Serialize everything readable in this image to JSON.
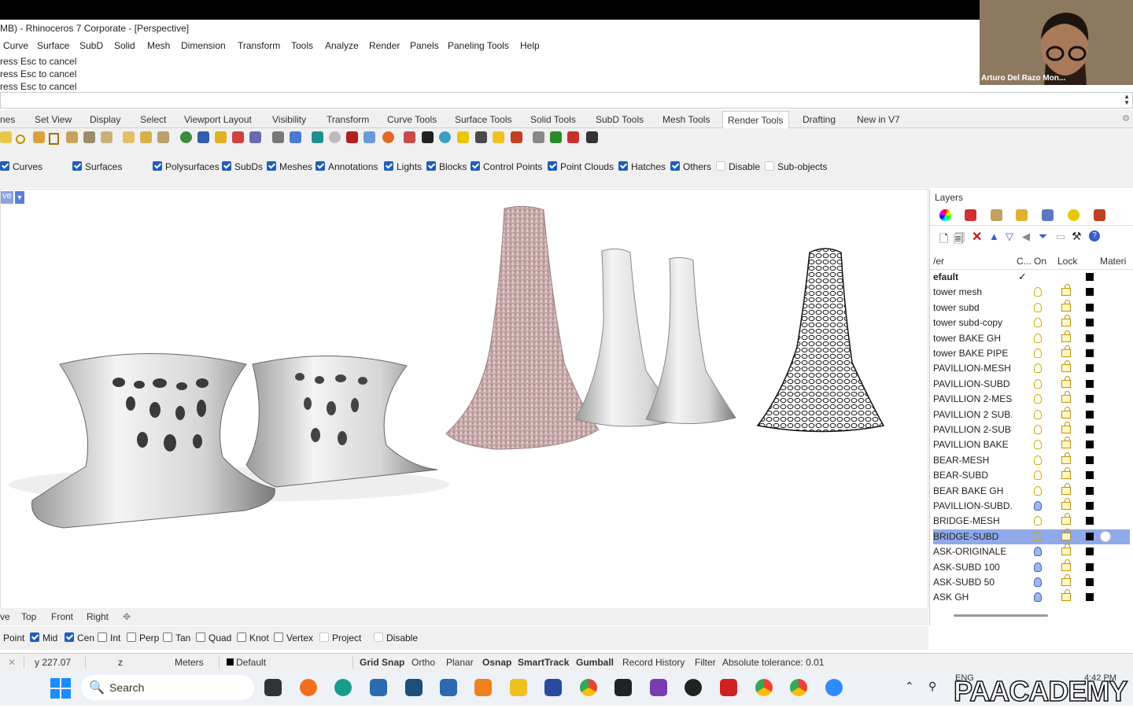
{
  "window": {
    "title": "MB) - Rhinoceros 7 Corporate - [Perspective]"
  },
  "menu": [
    "Curve",
    "Surface",
    "SubD",
    "Solid",
    "Mesh",
    "Dimension",
    "Transform",
    "Tools",
    "Analyze",
    "Render",
    "Panels",
    "Paneling Tools",
    "Help"
  ],
  "command_history": [
    "ress Esc to cancel",
    "ress Esc to cancel",
    "ress Esc to cancel"
  ],
  "toolbar_tabs": [
    "nes",
    "Set View",
    "Display",
    "Select",
    "Viewport Layout",
    "Visibility",
    "Transform",
    "Curve Tools",
    "Surface Tools",
    "Solid Tools",
    "SubD Tools",
    "Mesh Tools",
    "Render Tools",
    "Drafting",
    "New in V7"
  ],
  "active_tab": "Render Tools",
  "filters": [
    {
      "label": "Curves",
      "checked": true
    },
    {
      "label": "Surfaces",
      "checked": true
    },
    {
      "label": "Polysurfaces",
      "checked": true
    },
    {
      "label": "SubDs",
      "checked": true
    },
    {
      "label": "Meshes",
      "checked": true
    },
    {
      "label": "Annotations",
      "checked": true
    },
    {
      "label": "Lights",
      "checked": true
    },
    {
      "label": "Blocks",
      "checked": true
    },
    {
      "label": "Control Points",
      "checked": true
    },
    {
      "label": "Point Clouds",
      "checked": true
    },
    {
      "label": "Hatches",
      "checked": true
    },
    {
      "label": "Others",
      "checked": true
    },
    {
      "label": "Disable",
      "checked": false
    },
    {
      "label": "Sub-objects",
      "checked": false
    }
  ],
  "viewport": {
    "title": "ve"
  },
  "view_tabs": [
    "ve",
    "Top",
    "Front",
    "Right"
  ],
  "osnaps": [
    {
      "label": "Point",
      "checked": true
    },
    {
      "label": "Mid",
      "checked": true
    },
    {
      "label": "Cen",
      "checked": true
    },
    {
      "label": "Int",
      "checked": false
    },
    {
      "label": "Perp",
      "checked": false
    },
    {
      "label": "Tan",
      "checked": false
    },
    {
      "label": "Quad",
      "checked": false
    },
    {
      "label": "Knot",
      "checked": false
    },
    {
      "label": "Vertex",
      "checked": false
    },
    {
      "label": "Project",
      "checked": false
    },
    {
      "label": "Disable",
      "checked": false
    }
  ],
  "status": {
    "y": "y 227.07",
    "z": "z",
    "units": "Meters",
    "layer": "Default",
    "grid_snap": "Grid Snap",
    "ortho": "Ortho",
    "planar": "Planar",
    "osnap": "Osnap",
    "smarttrack": "SmartTrack",
    "gumball": "Gumball",
    "record_history": "Record History",
    "filter": "Filter",
    "tolerance": "Absolute tolerance: 0.01"
  },
  "layers_panel": {
    "title": "Layers",
    "columns": {
      "name": "/er",
      "current": "C...",
      "on": "On",
      "lock": "Lock",
      "material": "Materi"
    },
    "rows": [
      {
        "name": "efault",
        "current": true,
        "bulb": "none",
        "selected": false
      },
      {
        "name": "tower mesh",
        "bulb": "yellow",
        "selected": false
      },
      {
        "name": "tower subd",
        "bulb": "yellow",
        "selected": false
      },
      {
        "name": "tower subd-copy",
        "bulb": "yellow",
        "selected": false
      },
      {
        "name": "tower BAKE GH",
        "bulb": "yellow",
        "selected": false
      },
      {
        "name": "tower BAKE PIPE",
        "bulb": "yellow",
        "selected": false
      },
      {
        "name": "PAVILLION-MESH",
        "bulb": "yellow",
        "selected": false
      },
      {
        "name": "PAVILLION-SUBD",
        "bulb": "yellow",
        "selected": false
      },
      {
        "name": "PAVILLION 2-MES...",
        "bulb": "yellow",
        "selected": false
      },
      {
        "name": "PAVILLION 2 SUB...",
        "bulb": "yellow",
        "selected": false
      },
      {
        "name": "PAVILLION 2-SUBD",
        "bulb": "yellow",
        "selected": false
      },
      {
        "name": "PAVILLION BAKE ...",
        "bulb": "yellow",
        "selected": false
      },
      {
        "name": "BEAR-MESH",
        "bulb": "yellow",
        "selected": false
      },
      {
        "name": "BEAR-SUBD",
        "bulb": "yellow",
        "selected": false
      },
      {
        "name": "BEAR BAKE GH",
        "bulb": "yellow",
        "selected": false
      },
      {
        "name": "PAVILLION-SUBD...",
        "bulb": "blue",
        "selected": false
      },
      {
        "name": "BRIDGE-MESH",
        "bulb": "yellow",
        "selected": false
      },
      {
        "name": "BRIDGE-SUBD",
        "bulb": "yellow",
        "selected": true
      },
      {
        "name": "ASK-ORIGINALE",
        "bulb": "blue",
        "selected": false
      },
      {
        "name": "ASK-SUBD 100",
        "bulb": "blue",
        "selected": false
      },
      {
        "name": "ASK-SUBD 50",
        "bulb": "blue",
        "selected": false
      },
      {
        "name": "ASK GH",
        "bulb": "blue",
        "selected": false
      }
    ]
  },
  "webcam": {
    "name": "Arturo Del Razo Mon..."
  },
  "taskbar": {
    "search_label": "Search",
    "lang": "ENG",
    "time": "4:42 PM"
  },
  "watermark": "PAACADEMY"
}
